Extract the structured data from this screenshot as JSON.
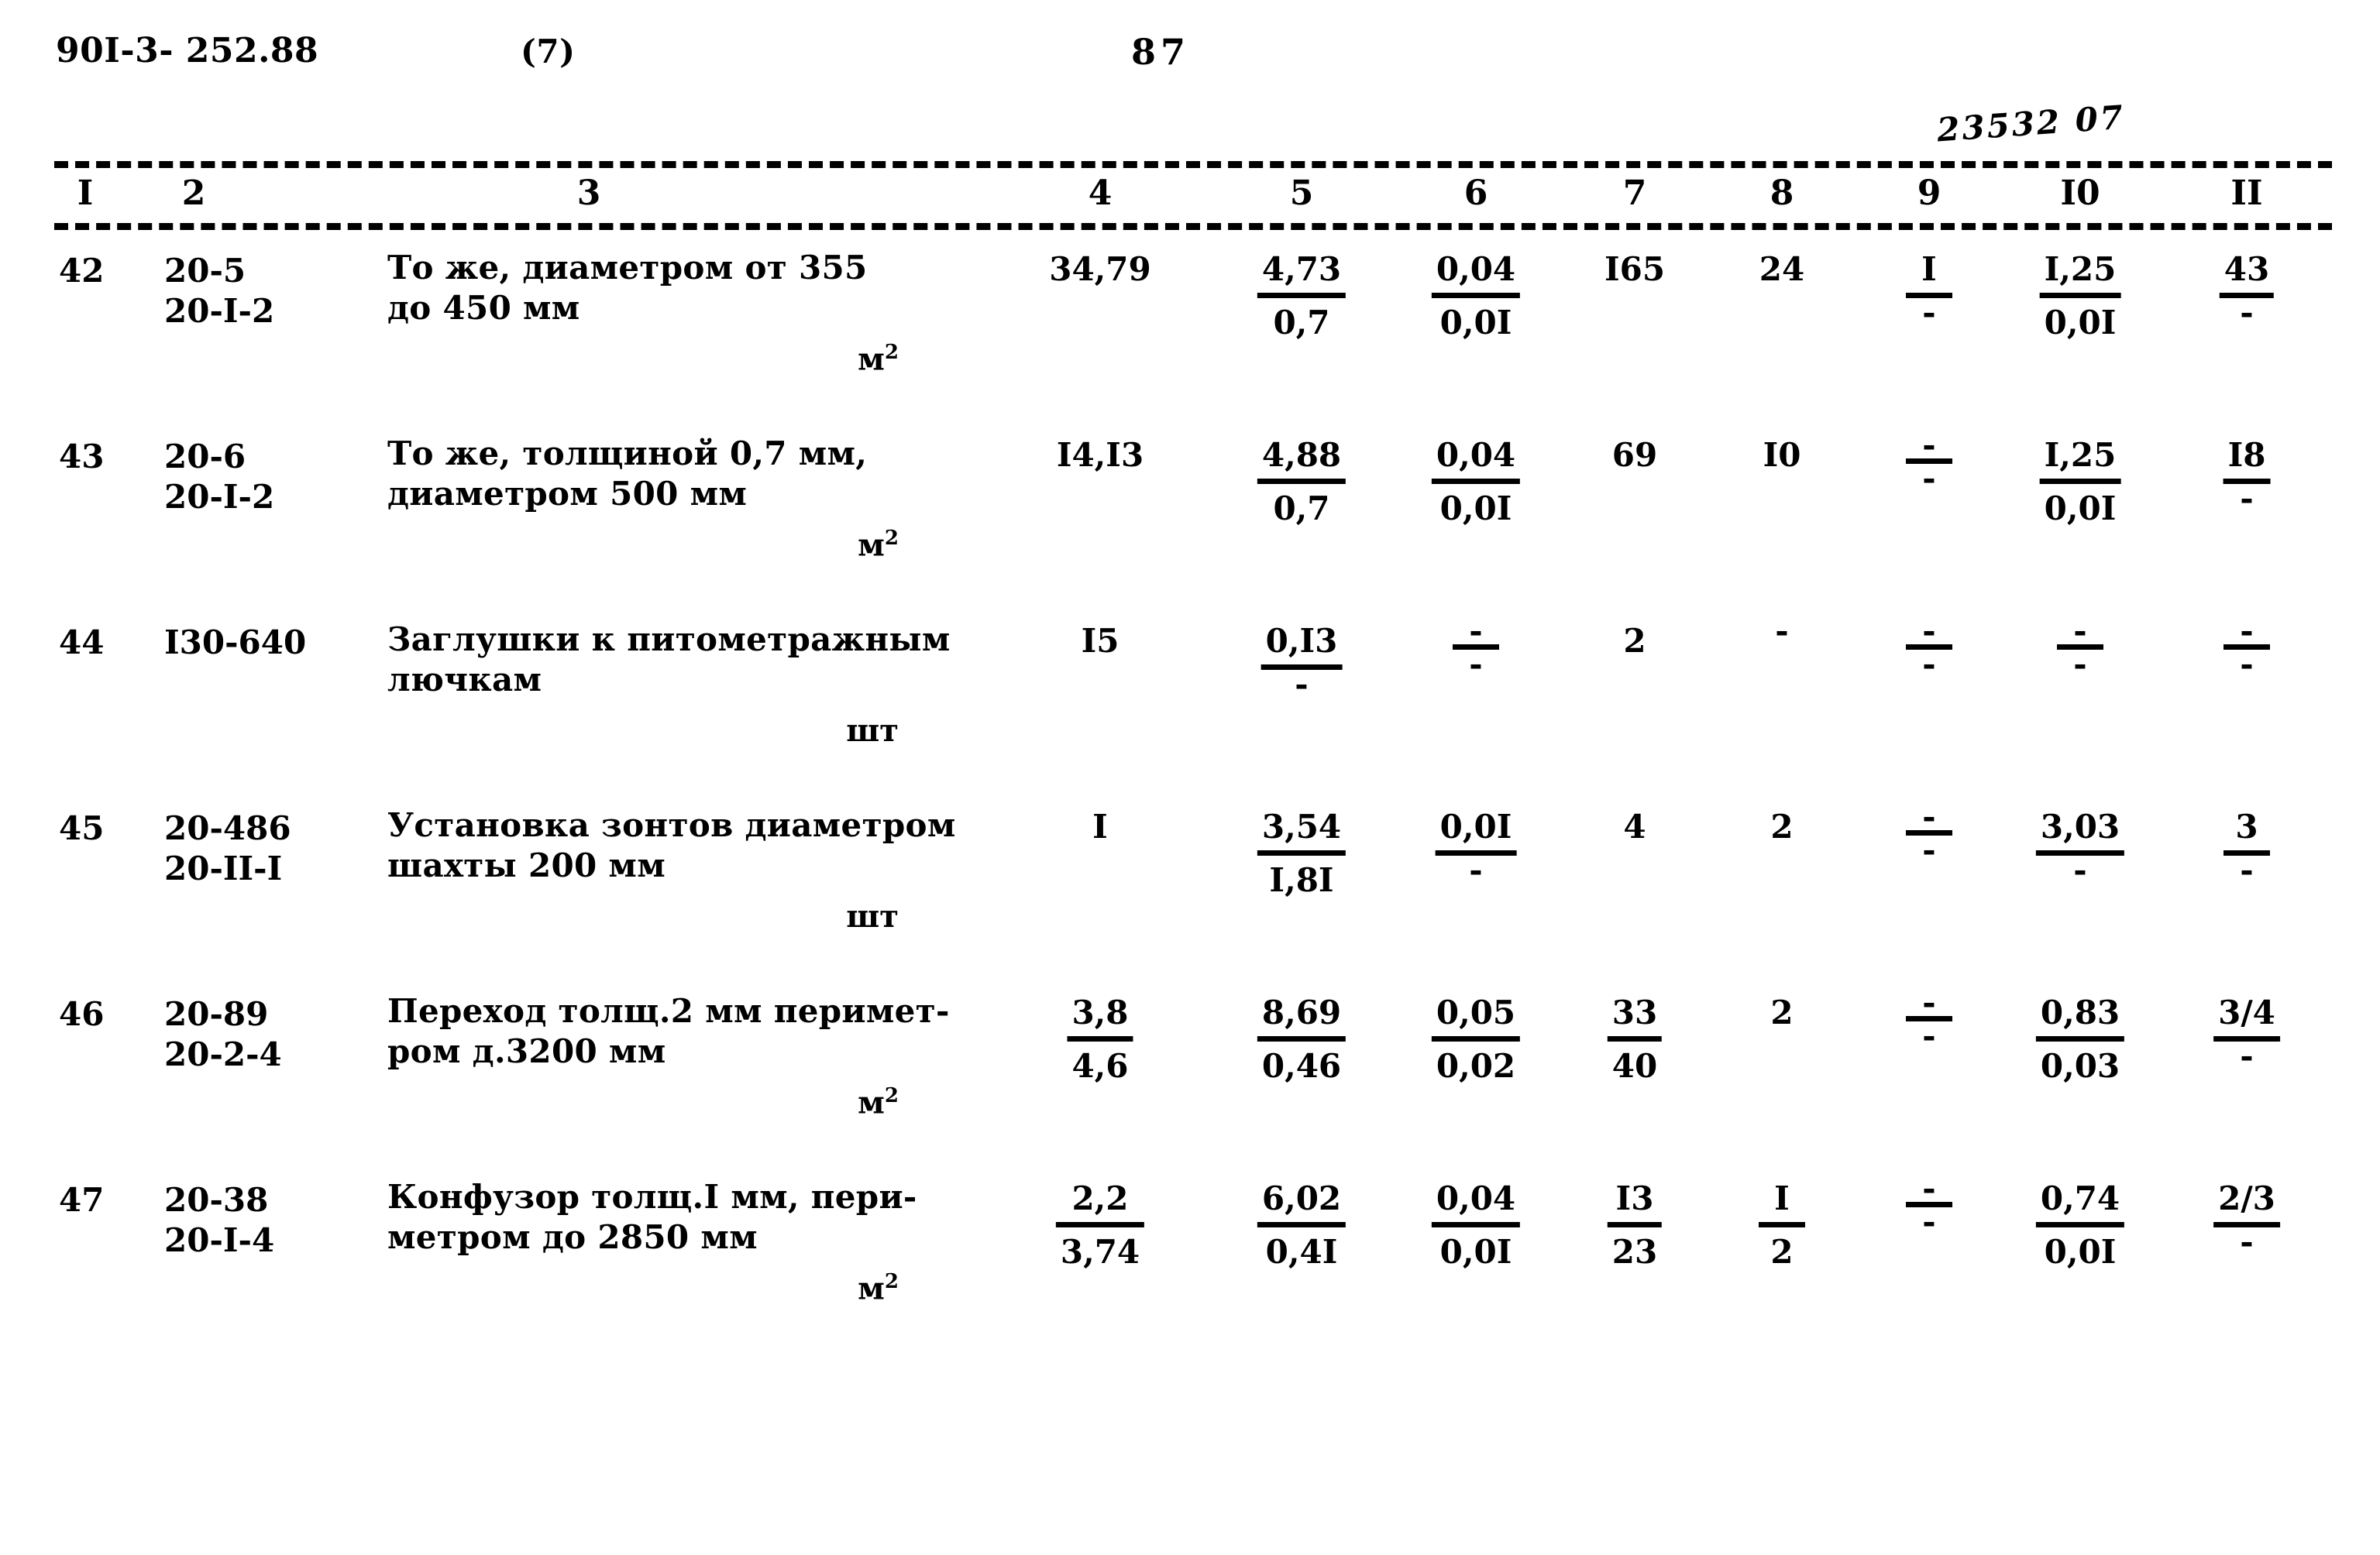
{
  "header": {
    "doc_code": "90I-3- 252.88",
    "sheet_paren": "(7)",
    "page_number": "87",
    "hand_note": "23532 07"
  },
  "table": {
    "column_headers": [
      "I",
      "2",
      "3",
      "4",
      "5",
      "6",
      "7",
      "8",
      "9",
      "I0",
      "II"
    ],
    "rows": [
      {
        "num": "42",
        "code": "20-5\n20-I-2",
        "desc": "То же, диаметром от 355\nдо 450 мм",
        "unit_text": "м",
        "unit_sup": "2",
        "c4_top": "34,79",
        "c4_bot": "",
        "c4_ruled": false,
        "c5_top": "4,73",
        "c5_bot": "0,7",
        "c5_ruled": true,
        "c6_top": "0,04",
        "c6_bot": "0,0I",
        "c6_ruled": true,
        "c7_top": "I65",
        "c7_bot": "",
        "c7_ruled": false,
        "c8_top": "24",
        "c8_bot": "",
        "c8_ruled": false,
        "c9_top": "I",
        "c9_bot": "-",
        "c9_ruled": true,
        "c10_top": "I,25",
        "c10_bot": "0,0I",
        "c10_ruled": true,
        "c11_top": "43",
        "c11_bot": "-",
        "c11_ruled": true
      },
      {
        "num": "43",
        "code": "20-6\n20-I-2",
        "desc": "То же, толщиной 0,7 мм,\nдиаметром 500 мм",
        "unit_text": "м",
        "unit_sup": "2",
        "c4_top": "I4,I3",
        "c4_bot": "",
        "c4_ruled": false,
        "c5_top": "4,88",
        "c5_bot": "0,7",
        "c5_ruled": true,
        "c6_top": "0,04",
        "c6_bot": "0,0I",
        "c6_ruled": true,
        "c7_top": "69",
        "c7_bot": "",
        "c7_ruled": false,
        "c8_top": "I0",
        "c8_bot": "",
        "c8_ruled": false,
        "c9_top": "-",
        "c9_bot": "-",
        "c9_ruled": true,
        "c10_top": "I,25",
        "c10_bot": "0,0I",
        "c10_ruled": true,
        "c11_top": "I8",
        "c11_bot": "-",
        "c11_ruled": true
      },
      {
        "num": "44",
        "code": "I30-640",
        "desc": "Заглушки к питометражным\nлючкам",
        "unit_text": "шт",
        "unit_sup": "",
        "c4_top": "I5",
        "c4_bot": "",
        "c4_ruled": false,
        "c5_top": "0,I3",
        "c5_bot": "-",
        "c5_ruled": true,
        "c6_top": "-",
        "c6_bot": "-",
        "c6_ruled": true,
        "c7_top": "2",
        "c7_bot": "",
        "c7_ruled": false,
        "c8_top": "-",
        "c8_bot": "",
        "c8_ruled": false,
        "c9_top": "-",
        "c9_bot": "-",
        "c9_ruled": true,
        "c10_top": "-",
        "c10_bot": "-",
        "c10_ruled": true,
        "c11_top": "-",
        "c11_bot": "-",
        "c11_ruled": true
      },
      {
        "num": "45",
        "code": "20-486\n20-II-I",
        "desc": "Установка зонтов диаметром\nшахты 200 мм",
        "unit_text": "шт",
        "unit_sup": "",
        "c4_top": "I",
        "c4_bot": "",
        "c4_ruled": false,
        "c5_top": "3,54",
        "c5_bot": "I,8I",
        "c5_ruled": true,
        "c6_top": "0,0I",
        "c6_bot": "-",
        "c6_ruled": true,
        "c7_top": "4",
        "c7_bot": "",
        "c7_ruled": false,
        "c8_top": "2",
        "c8_bot": "",
        "c8_ruled": false,
        "c9_top": "-",
        "c9_bot": "-",
        "c9_ruled": true,
        "c10_top": "3,03",
        "c10_bot": "-",
        "c10_ruled": true,
        "c11_top": "3",
        "c11_bot": "-",
        "c11_ruled": true
      },
      {
        "num": "46",
        "code": "20-89\n20-2-4",
        "desc": "Переход толщ.2 мм перимет-\nром д.3200 мм",
        "unit_text": "м",
        "unit_sup": "2",
        "c4_top": "3,8",
        "c4_bot": "4,6",
        "c4_ruled": true,
        "c5_top": "8,69",
        "c5_bot": "0,46",
        "c5_ruled": true,
        "c6_top": "0,05",
        "c6_bot": "0,02",
        "c6_ruled": true,
        "c7_top": "33",
        "c7_bot": "40",
        "c7_ruled": true,
        "c8_top": "2",
        "c8_bot": "",
        "c8_ruled": false,
        "c9_top": "-",
        "c9_bot": "-",
        "c9_ruled": true,
        "c10_top": "0,83",
        "c10_bot": "0,03",
        "c10_ruled": true,
        "c11_top": "3/4",
        "c11_bot": "-",
        "c11_ruled": true
      },
      {
        "num": "47",
        "code": "20-38\n20-I-4",
        "desc": "Конфузор толщ.I мм, пери-\nметром до 2850 мм",
        "unit_text": "м",
        "unit_sup": "2",
        "c4_top": "2,2",
        "c4_bot": "3,74",
        "c4_ruled": true,
        "c5_top": "6,02",
        "c5_bot": "0,4I",
        "c5_ruled": true,
        "c6_top": "0,04",
        "c6_bot": "0,0I",
        "c6_ruled": true,
        "c7_top": "I3",
        "c7_bot": "23",
        "c7_ruled": true,
        "c8_top": "I",
        "c8_bot": "2",
        "c8_ruled": true,
        "c9_top": "-",
        "c9_bot": "-",
        "c9_ruled": true,
        "c10_top": "0,74",
        "c10_bot": "0,0I",
        "c10_ruled": true,
        "c11_top": "2/3",
        "c11_bot": "-",
        "c11_ruled": true
      }
    ]
  }
}
